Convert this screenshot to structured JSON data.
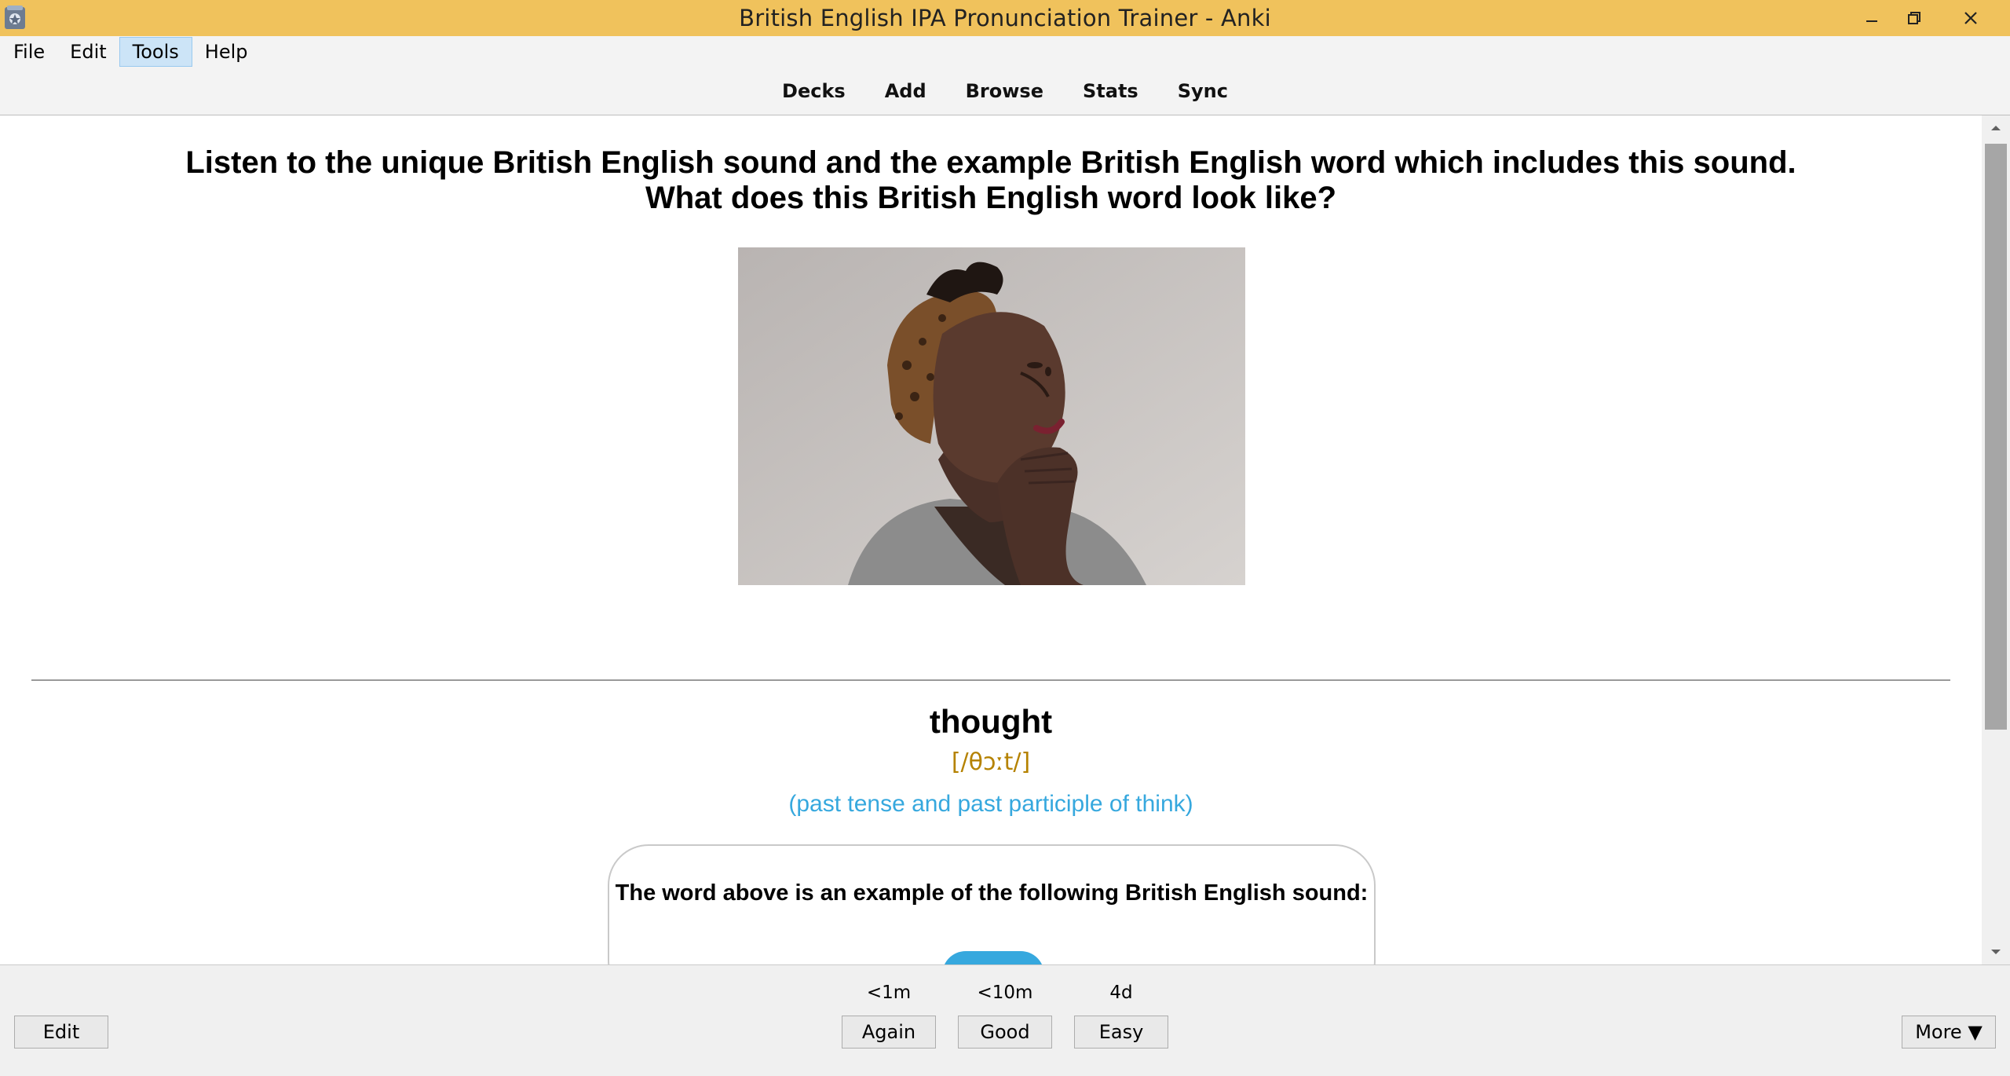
{
  "window": {
    "title": "British English IPA Pronunciation Trainer - Anki",
    "accent_color": "#f0c25c"
  },
  "menubar": {
    "items": [
      {
        "label": "File"
      },
      {
        "label": "Edit"
      },
      {
        "label": "Tools",
        "active": true
      },
      {
        "label": "Help"
      }
    ]
  },
  "toolbar": {
    "links": [
      "Decks",
      "Add",
      "Browse",
      "Stats",
      "Sync"
    ]
  },
  "card": {
    "question_line1": "Listen to the unique British English sound and the example British English word which includes this sound.",
    "question_line2": "What does this British English word look like?",
    "image": "photo-of-thinking-woman",
    "word": "thought",
    "ipa": "[/θɔːt/]",
    "meaning": "(past tense and past participle of think)",
    "sound_label": "The word above is an example of the following British English sound:",
    "colors": {
      "ipa": "#b58200",
      "meaning": "#36a8de"
    }
  },
  "bottombar": {
    "edit_label": "Edit",
    "more_label": "More ▼",
    "answers": [
      {
        "interval": "<1m",
        "label": "Again"
      },
      {
        "interval": "<10m",
        "label": "Good"
      },
      {
        "interval": "4d",
        "label": "Easy"
      }
    ]
  }
}
